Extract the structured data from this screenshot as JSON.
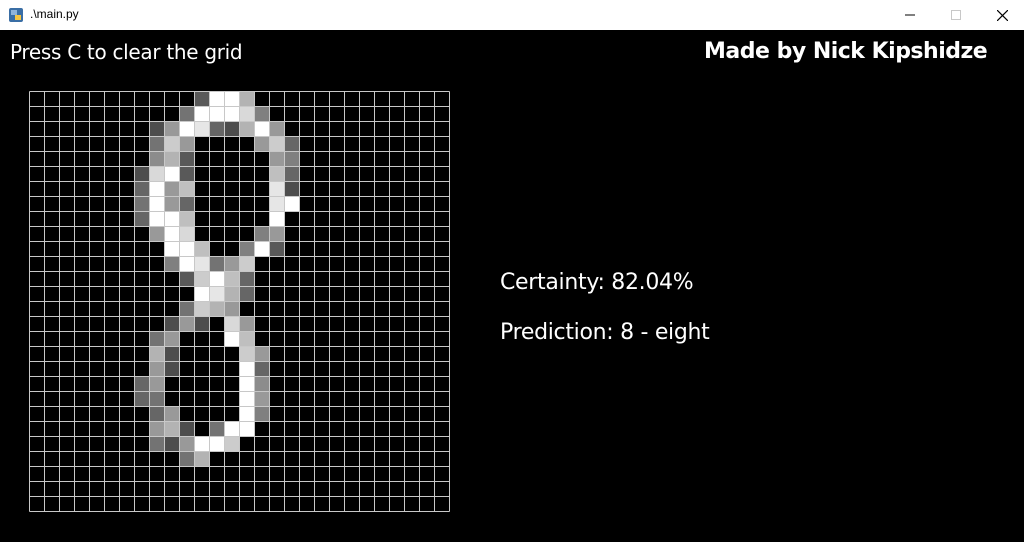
{
  "window": {
    "title": ".\\main.py",
    "icon": "python-icon",
    "controls": [
      "minimize-icon",
      "maximize-icon",
      "close-icon"
    ]
  },
  "header": {
    "instructions": "Press C to clear the grid",
    "credit": "Made by Nick Kipshidze"
  },
  "result": {
    "certainty": "Certainty: 82.04%",
    "prediction": "Prediction: 8 - eight"
  },
  "drawing_grid": {
    "rows": 28,
    "cols": 28,
    "cell_color": "#000000",
    "line_color": "#c8c8c8",
    "cells": [
      {
        "r": 0,
        "c": 11,
        "v": 0.35
      },
      {
        "r": 0,
        "c": 12,
        "v": 1
      },
      {
        "r": 0,
        "c": 13,
        "v": 1
      },
      {
        "r": 0,
        "c": 14,
        "v": 0.7
      },
      {
        "r": 1,
        "c": 10,
        "v": 0.45
      },
      {
        "r": 1,
        "c": 11,
        "v": 1
      },
      {
        "r": 1,
        "c": 12,
        "v": 1
      },
      {
        "r": 1,
        "c": 13,
        "v": 1
      },
      {
        "r": 1,
        "c": 14,
        "v": 0.85
      },
      {
        "r": 1,
        "c": 15,
        "v": 0.5
      },
      {
        "r": 2,
        "c": 8,
        "v": 0.3
      },
      {
        "r": 2,
        "c": 9,
        "v": 0.6
      },
      {
        "r": 2,
        "c": 10,
        "v": 1
      },
      {
        "r": 2,
        "c": 11,
        "v": 0.9
      },
      {
        "r": 2,
        "c": 12,
        "v": 0.4
      },
      {
        "r": 2,
        "c": 13,
        "v": 0.3
      },
      {
        "r": 2,
        "c": 14,
        "v": 0.7
      },
      {
        "r": 2,
        "c": 15,
        "v": 1
      },
      {
        "r": 2,
        "c": 16,
        "v": 0.6
      },
      {
        "r": 3,
        "c": 8,
        "v": 0.45
      },
      {
        "r": 3,
        "c": 9,
        "v": 0.8
      },
      {
        "r": 3,
        "c": 10,
        "v": 0.6
      },
      {
        "r": 3,
        "c": 15,
        "v": 0.6
      },
      {
        "r": 3,
        "c": 16,
        "v": 0.8
      },
      {
        "r": 3,
        "c": 17,
        "v": 0.4
      },
      {
        "r": 4,
        "c": 8,
        "v": 0.55
      },
      {
        "r": 4,
        "c": 9,
        "v": 0.7
      },
      {
        "r": 4,
        "c": 10,
        "v": 0.35
      },
      {
        "r": 4,
        "c": 16,
        "v": 0.6
      },
      {
        "r": 4,
        "c": 17,
        "v": 0.5
      },
      {
        "r": 5,
        "c": 7,
        "v": 0.3
      },
      {
        "r": 5,
        "c": 8,
        "v": 0.85
      },
      {
        "r": 5,
        "c": 9,
        "v": 1
      },
      {
        "r": 5,
        "c": 10,
        "v": 0.35
      },
      {
        "r": 5,
        "c": 16,
        "v": 0.75
      },
      {
        "r": 5,
        "c": 17,
        "v": 0.4
      },
      {
        "r": 6,
        "c": 7,
        "v": 0.4
      },
      {
        "r": 6,
        "c": 8,
        "v": 1
      },
      {
        "r": 6,
        "c": 9,
        "v": 0.6
      },
      {
        "r": 6,
        "c": 10,
        "v": 0.75
      },
      {
        "r": 6,
        "c": 16,
        "v": 0.9
      },
      {
        "r": 6,
        "c": 17,
        "v": 0.3
      },
      {
        "r": 7,
        "c": 7,
        "v": 0.45
      },
      {
        "r": 7,
        "c": 8,
        "v": 1
      },
      {
        "r": 7,
        "c": 9,
        "v": 0.6
      },
      {
        "r": 7,
        "c": 10,
        "v": 0.4
      },
      {
        "r": 7,
        "c": 16,
        "v": 0.9
      },
      {
        "r": 7,
        "c": 17,
        "v": 1
      },
      {
        "r": 8,
        "c": 7,
        "v": 0.4
      },
      {
        "r": 8,
        "c": 8,
        "v": 1
      },
      {
        "r": 8,
        "c": 9,
        "v": 1
      },
      {
        "r": 8,
        "c": 10,
        "v": 0.75
      },
      {
        "r": 8,
        "c": 16,
        "v": 1
      },
      {
        "r": 9,
        "c": 8,
        "v": 0.6
      },
      {
        "r": 9,
        "c": 9,
        "v": 1
      },
      {
        "r": 9,
        "c": 10,
        "v": 0.85
      },
      {
        "r": 9,
        "c": 15,
        "v": 0.5
      },
      {
        "r": 9,
        "c": 16,
        "v": 0.6
      },
      {
        "r": 10,
        "c": 9,
        "v": 1
      },
      {
        "r": 10,
        "c": 10,
        "v": 1
      },
      {
        "r": 10,
        "c": 11,
        "v": 0.75
      },
      {
        "r": 10,
        "c": 14,
        "v": 0.5
      },
      {
        "r": 10,
        "c": 15,
        "v": 1
      },
      {
        "r": 10,
        "c": 16,
        "v": 0.35
      },
      {
        "r": 11,
        "c": 9,
        "v": 0.5
      },
      {
        "r": 11,
        "c": 10,
        "v": 1
      },
      {
        "r": 11,
        "c": 11,
        "v": 0.9
      },
      {
        "r": 11,
        "c": 12,
        "v": 0.45
      },
      {
        "r": 11,
        "c": 13,
        "v": 0.6
      },
      {
        "r": 11,
        "c": 14,
        "v": 0.8
      },
      {
        "r": 12,
        "c": 10,
        "v": 0.35
      },
      {
        "r": 12,
        "c": 11,
        "v": 0.8
      },
      {
        "r": 12,
        "c": 12,
        "v": 1
      },
      {
        "r": 12,
        "c": 13,
        "v": 0.75
      },
      {
        "r": 12,
        "c": 14,
        "v": 0.4
      },
      {
        "r": 13,
        "c": 11,
        "v": 1
      },
      {
        "r": 13,
        "c": 12,
        "v": 0.9
      },
      {
        "r": 13,
        "c": 13,
        "v": 0.7
      },
      {
        "r": 13,
        "c": 14,
        "v": 0.4
      },
      {
        "r": 14,
        "c": 10,
        "v": 0.45
      },
      {
        "r": 14,
        "c": 11,
        "v": 0.8
      },
      {
        "r": 14,
        "c": 12,
        "v": 0.7
      },
      {
        "r": 14,
        "c": 13,
        "v": 0.6
      },
      {
        "r": 15,
        "c": 9,
        "v": 0.3
      },
      {
        "r": 15,
        "c": 10,
        "v": 0.6
      },
      {
        "r": 15,
        "c": 11,
        "v": 0.3
      },
      {
        "r": 15,
        "c": 13,
        "v": 0.85
      },
      {
        "r": 15,
        "c": 14,
        "v": 0.6
      },
      {
        "r": 16,
        "c": 8,
        "v": 0.45
      },
      {
        "r": 16,
        "c": 9,
        "v": 0.6
      },
      {
        "r": 16,
        "c": 13,
        "v": 1
      },
      {
        "r": 16,
        "c": 14,
        "v": 0.75
      },
      {
        "r": 17,
        "c": 8,
        "v": 0.7
      },
      {
        "r": 17,
        "c": 9,
        "v": 0.3
      },
      {
        "r": 17,
        "c": 14,
        "v": 0.8
      },
      {
        "r": 17,
        "c": 15,
        "v": 0.6
      },
      {
        "r": 18,
        "c": 8,
        "v": 0.6
      },
      {
        "r": 18,
        "c": 9,
        "v": 0.3
      },
      {
        "r": 18,
        "c": 14,
        "v": 1
      },
      {
        "r": 18,
        "c": 15,
        "v": 0.4
      },
      {
        "r": 19,
        "c": 7,
        "v": 0.4
      },
      {
        "r": 19,
        "c": 8,
        "v": 0.6
      },
      {
        "r": 19,
        "c": 14,
        "v": 1
      },
      {
        "r": 19,
        "c": 15,
        "v": 0.55
      },
      {
        "r": 20,
        "c": 7,
        "v": 0.4
      },
      {
        "r": 20,
        "c": 8,
        "v": 0.45
      },
      {
        "r": 20,
        "c": 14,
        "v": 1
      },
      {
        "r": 20,
        "c": 15,
        "v": 0.6
      },
      {
        "r": 21,
        "c": 8,
        "v": 0.4
      },
      {
        "r": 21,
        "c": 9,
        "v": 0.6
      },
      {
        "r": 21,
        "c": 14,
        "v": 1
      },
      {
        "r": 21,
        "c": 15,
        "v": 0.5
      },
      {
        "r": 22,
        "c": 8,
        "v": 0.6
      },
      {
        "r": 22,
        "c": 9,
        "v": 0.7
      },
      {
        "r": 22,
        "c": 10,
        "v": 0.3
      },
      {
        "r": 22,
        "c": 12,
        "v": 0.45
      },
      {
        "r": 22,
        "c": 13,
        "v": 1
      },
      {
        "r": 22,
        "c": 14,
        "v": 1
      },
      {
        "r": 23,
        "c": 8,
        "v": 0.45
      },
      {
        "r": 23,
        "c": 9,
        "v": 0.3
      },
      {
        "r": 23,
        "c": 10,
        "v": 0.6
      },
      {
        "r": 23,
        "c": 11,
        "v": 1
      },
      {
        "r": 23,
        "c": 12,
        "v": 1
      },
      {
        "r": 23,
        "c": 13,
        "v": 0.8
      },
      {
        "r": 24,
        "c": 10,
        "v": 0.45
      },
      {
        "r": 24,
        "c": 11,
        "v": 0.7
      }
    ]
  }
}
